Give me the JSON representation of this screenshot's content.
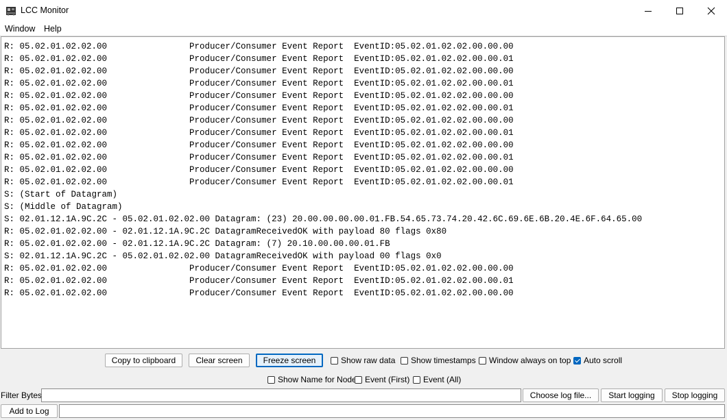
{
  "window": {
    "title": "LCC Monitor"
  },
  "menu": {
    "items": [
      "Window",
      "Help"
    ]
  },
  "log": {
    "lines": [
      "R: 05.02.01.02.02.00                Producer/Consumer Event Report  EventID:05.02.01.02.02.00.00.00",
      "R: 05.02.01.02.02.00                Producer/Consumer Event Report  EventID:05.02.01.02.02.00.00.01",
      "R: 05.02.01.02.02.00                Producer/Consumer Event Report  EventID:05.02.01.02.02.00.00.00",
      "R: 05.02.01.02.02.00                Producer/Consumer Event Report  EventID:05.02.01.02.02.00.00.01",
      "R: 05.02.01.02.02.00                Producer/Consumer Event Report  EventID:05.02.01.02.02.00.00.00",
      "R: 05.02.01.02.02.00                Producer/Consumer Event Report  EventID:05.02.01.02.02.00.00.01",
      "R: 05.02.01.02.02.00                Producer/Consumer Event Report  EventID:05.02.01.02.02.00.00.00",
      "R: 05.02.01.02.02.00                Producer/Consumer Event Report  EventID:05.02.01.02.02.00.00.01",
      "R: 05.02.01.02.02.00                Producer/Consumer Event Report  EventID:05.02.01.02.02.00.00.00",
      "R: 05.02.01.02.02.00                Producer/Consumer Event Report  EventID:05.02.01.02.02.00.00.01",
      "R: 05.02.01.02.02.00                Producer/Consumer Event Report  EventID:05.02.01.02.02.00.00.00",
      "R: 05.02.01.02.02.00                Producer/Consumer Event Report  EventID:05.02.01.02.02.00.00.01",
      "S: (Start of Datagram)",
      "S: (Middle of Datagram)",
      "S: 02.01.12.1A.9C.2C - 05.02.01.02.02.00 Datagram: (23) 20.00.00.00.00.01.FB.54.65.73.74.20.42.6C.69.6E.6B.20.4E.6F.64.65.00",
      "R: 05.02.01.02.02.00 - 02.01.12.1A.9C.2C DatagramReceivedOK with payload 80 flags 0x80",
      "R: 05.02.01.02.02.00 - 02.01.12.1A.9C.2C Datagram: (7) 20.10.00.00.00.01.FB",
      "S: 02.01.12.1A.9C.2C - 05.02.01.02.02.00 DatagramReceivedOK with payload 00 flags 0x0",
      "R: 05.02.01.02.02.00                Producer/Consumer Event Report  EventID:05.02.01.02.02.00.00.00",
      "R: 05.02.01.02.02.00                Producer/Consumer Event Report  EventID:05.02.01.02.02.00.00.01",
      "R: 05.02.01.02.02.00                Producer/Consumer Event Report  EventID:05.02.01.02.02.00.00.00"
    ]
  },
  "controls": {
    "copy_label": "Copy to clipboard",
    "clear_label": "Clear screen",
    "freeze_label": "Freeze screen",
    "show_raw_label": "Show raw data",
    "show_timestamps_label": "Show timestamps",
    "always_on_top_label": "Window always on top",
    "auto_scroll_label": "Auto scroll",
    "show_name_label": "Show Name for Node",
    "event_first_label": "Event (First)",
    "event_all_label": "Event (All)",
    "show_raw_checked": false,
    "show_timestamps_checked": false,
    "always_on_top_checked": false,
    "auto_scroll_checked": true,
    "show_name_checked": false,
    "event_first_checked": false,
    "event_all_checked": false
  },
  "filter": {
    "label": "Filter Bytes:",
    "value": "",
    "choose_log_label": "Choose log file...",
    "start_logging_label": "Start logging",
    "stop_logging_label": "Stop logging"
  },
  "addlog": {
    "button_label": "Add to Log",
    "value": ""
  },
  "colors": {
    "accent": "#0067c0",
    "background": "#f0f0f0"
  }
}
